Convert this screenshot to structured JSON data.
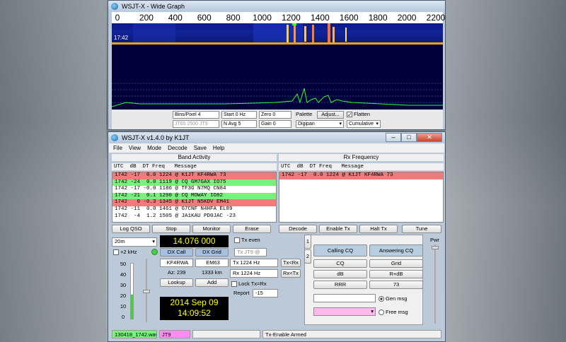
{
  "wide_graph": {
    "title": "WSJT-X - Wide Graph",
    "axis_ticks": [
      "0",
      "200",
      "400",
      "600",
      "800",
      "1000",
      "1200",
      "1400",
      "1600",
      "1800",
      "2000",
      "2200"
    ],
    "waterfall_time": "17:42",
    "controls": {
      "bins_pixel": "Bins/Pixel  4",
      "start": "Start  0 Hz",
      "zero": "Zero  0",
      "palette_label": "Palette",
      "adjust": "Adjust...",
      "flatten_label": "Flatten",
      "mode_info": "JT65  2500  JT9",
      "n_avg": "N Avg  5",
      "gain": "Gain  0",
      "palette_value": "Digipan",
      "spectrum_value": "Cumulative"
    }
  },
  "main": {
    "title": "WSJT-X    v1.4.0    by K1JT",
    "menu": [
      "File",
      "View",
      "Mode",
      "Decode",
      "Save",
      "Help"
    ],
    "band_activity": {
      "title": "Band Activity",
      "header": "UTC  dB  DT Freq   Message",
      "rows": [
        {
          "text": "1742 -17  0.0 1224 @ K1JT KF4RWA 73",
          "color": "red"
        },
        {
          "text": "1742 -24  0.0 1119 @ CQ GM7GAX IO75",
          "color": "green"
        },
        {
          "text": "1742 -17 -0.0 1186 @ TF3G N7MQ CN84",
          "color": "white"
        },
        {
          "text": "1742 -21  0.1 1290 @ CQ MOWAY IO82",
          "color": "green"
        },
        {
          "text": "1742   0 -0.3 1345 @ K1JT N5KDV EM41",
          "color": "red"
        },
        {
          "text": "1742 -11  0.0 1461 @ G7CNF N4HFA EL89",
          "color": "white"
        },
        {
          "text": "1742  -4  1.2 1505 @ JA1KAU PD0JAC -23",
          "color": "white"
        }
      ]
    },
    "rx_frequency": {
      "title": "Rx Frequency",
      "header": "UTC  dB  DT Freq   Message",
      "rows": [
        {
          "text": "1742 -17  0.0 1224 @ K1JT KF4RWA 73",
          "color": "red"
        }
      ]
    },
    "buttons": {
      "log_qso": "Log QSO",
      "stop": "Stop",
      "monitor": "Monitor",
      "erase": "Erase",
      "decode": "Decode",
      "enable_tx": "Enable Tx",
      "halt_tx": "Halt Tx",
      "tune": "Tune"
    },
    "band": "20m",
    "plus2khz": "+2 kHz",
    "frequency": "14.076 000",
    "dx_call_btn": "DX Call",
    "dx_grid_btn": "DX Grid",
    "tx_jt9": "Tx JT9 @",
    "tx_even": "Tx even",
    "dx_call_value": "KF4RWA",
    "dx_grid_value": "EM63",
    "az": "Az: 239",
    "distance": "1333 km",
    "lookup": "Lookup",
    "add": "Add",
    "tx_freq": "Tx  1224  Hz",
    "rx_freq": "Rx  1224  Hz",
    "tx_from_rx": "Tx<Rx",
    "rx_from_tx": "Rx<Tx",
    "lock_tx_rx": "Lock Tx=Rx",
    "report_label": "Report",
    "report_value": "-15",
    "date": "2014 Sep 09",
    "time": "14:09:52",
    "meter_ticks": [
      "50",
      "40",
      "30",
      "20",
      "10",
      "0"
    ],
    "pwr": "Pwr",
    "tab1": "1",
    "tab2": "2",
    "calling_cq": "Calling CQ",
    "answering_cq": "Answering CQ",
    "cq": "CQ",
    "grid": "Grid",
    "db": "dB",
    "r_db": "R+dB",
    "rrr": "RRR",
    "seventy_three": "73",
    "gen_msg": "Gen msg",
    "free_msg": "Free msg",
    "status": {
      "file": "130418_1742.wav",
      "mode": "JT9",
      "tx_state": "Tx-Enable Armed"
    }
  }
}
